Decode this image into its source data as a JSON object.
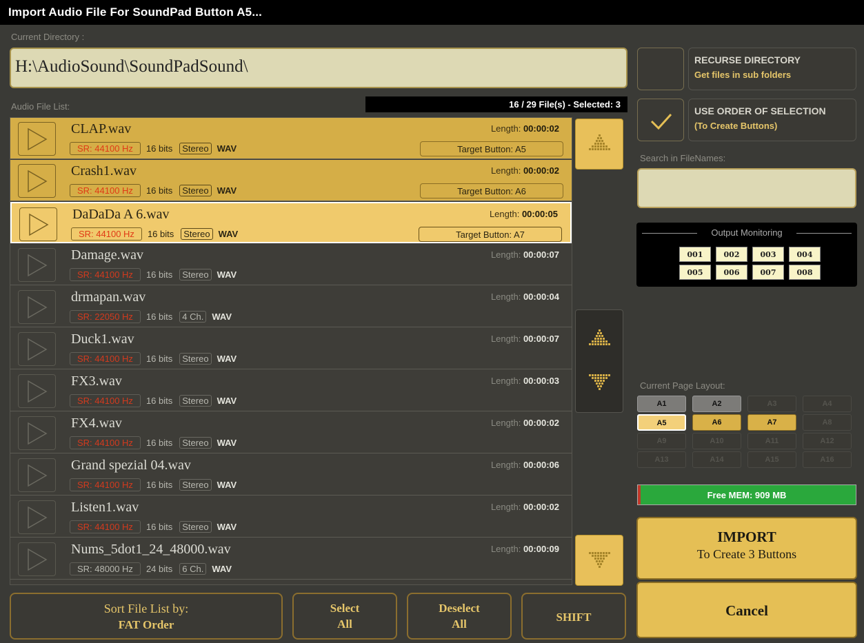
{
  "title": "Import Audio File For SoundPad Button A5...",
  "current_directory": {
    "label": "Current Directory :",
    "path": "H:\\AudioSound\\SoundPadSound\\"
  },
  "file_list": {
    "label": "Audio File List:",
    "count_text": "16 / 29 File(s) - Selected: 3",
    "length_label": "Length:",
    "bits_suffix": "bits",
    "files": [
      {
        "name": "CLAP.wav",
        "length": "00:00:02",
        "sr": "SR: 44100 Hz",
        "bits": "16",
        "channels": "Stereo",
        "format": "WAV",
        "target": "Target Button: A5",
        "state": "selected"
      },
      {
        "name": "Crash1.wav",
        "length": "00:00:02",
        "sr": "SR: 44100 Hz",
        "bits": "16",
        "channels": "Stereo",
        "format": "WAV",
        "target": "Target Button: A6",
        "state": "selected"
      },
      {
        "name": "DaDaDa A 6.wav",
        "length": "00:00:05",
        "sr": "SR: 44100 Hz",
        "bits": "16",
        "channels": "Stereo",
        "format": "WAV",
        "target": "Target Button: A7",
        "state": "current"
      },
      {
        "name": "Damage.wav",
        "length": "00:00:07",
        "sr": "SR: 44100 Hz",
        "bits": "16",
        "channels": "Stereo",
        "format": "WAV",
        "target": "",
        "state": "normal"
      },
      {
        "name": "drmapan.wav",
        "length": "00:00:04",
        "sr": "SR: 22050 Hz",
        "bits": "16",
        "channels": "4 Ch.",
        "format": "WAV",
        "target": "",
        "state": "normal"
      },
      {
        "name": "Duck1.wav",
        "length": "00:00:07",
        "sr": "SR: 44100 Hz",
        "bits": "16",
        "channels": "Stereo",
        "format": "WAV",
        "target": "",
        "state": "normal"
      },
      {
        "name": "FX3.wav",
        "length": "00:00:03",
        "sr": "SR: 44100 Hz",
        "bits": "16",
        "channels": "Stereo",
        "format": "WAV",
        "target": "",
        "state": "normal"
      },
      {
        "name": "FX4.wav",
        "length": "00:00:02",
        "sr": "SR: 44100 Hz",
        "bits": "16",
        "channels": "Stereo",
        "format": "WAV",
        "target": "",
        "state": "normal"
      },
      {
        "name": "Grand spezial 04.wav",
        "length": "00:00:06",
        "sr": "SR: 44100 Hz",
        "bits": "16",
        "channels": "Stereo",
        "format": "WAV",
        "target": "",
        "state": "normal"
      },
      {
        "name": "Listen1.wav",
        "length": "00:00:02",
        "sr": "SR: 44100 Hz",
        "bits": "16",
        "channels": "Stereo",
        "format": "WAV",
        "target": "",
        "state": "normal"
      },
      {
        "name": "Nums_5dot1_24_48000.wav",
        "length": "00:00:09",
        "sr": "SR: 48000 Hz",
        "bits": "24",
        "channels": "6 Ch.",
        "format": "WAV",
        "target": "",
        "state": "normal",
        "sr_normal": true
      }
    ]
  },
  "options": {
    "recurse": {
      "title": "RECURSE DIRECTORY",
      "subtitle": "Get files in sub folders",
      "checked": false
    },
    "order": {
      "title": "USE ORDER OF SELECTION",
      "subtitle": "(To Create Buttons)",
      "checked": true
    }
  },
  "search": {
    "label": "Search in FileNames:",
    "value": ""
  },
  "output_monitoring": {
    "title": "Output Monitoring",
    "channels": [
      "001",
      "002",
      "003",
      "004",
      "005",
      "006",
      "007",
      "008"
    ]
  },
  "page_layout": {
    "label": "Current Page Layout:",
    "buttons": [
      {
        "label": "A1",
        "state": "grey"
      },
      {
        "label": "A2",
        "state": "grey"
      },
      {
        "label": "A3",
        "state": "empty"
      },
      {
        "label": "A4",
        "state": "empty"
      },
      {
        "label": "A5",
        "state": "current"
      },
      {
        "label": "A6",
        "state": "gold"
      },
      {
        "label": "A7",
        "state": "gold"
      },
      {
        "label": "A8",
        "state": "empty"
      },
      {
        "label": "A9",
        "state": "empty"
      },
      {
        "label": "A10",
        "state": "empty"
      },
      {
        "label": "A11",
        "state": "empty"
      },
      {
        "label": "A12",
        "state": "empty"
      },
      {
        "label": "A13",
        "state": "empty"
      },
      {
        "label": "A14",
        "state": "empty"
      },
      {
        "label": "A15",
        "state": "empty"
      },
      {
        "label": "A16",
        "state": "empty"
      }
    ]
  },
  "memory": {
    "text": "Free MEM: 909 MB"
  },
  "import_button": {
    "line1": "IMPORT",
    "line2": "To Create 3 Buttons"
  },
  "cancel_button": {
    "label": "Cancel"
  },
  "bottom": {
    "sort": {
      "line1": "Sort File List by:",
      "line2": "FAT Order"
    },
    "select_all": {
      "line1": "Select",
      "line2": "All"
    },
    "deselect_all": {
      "line1": "Deselect",
      "line2": "All"
    },
    "shift": {
      "label": "SHIFT"
    }
  },
  "colors": {
    "accent": "#e5bf55",
    "selected_row": "#d5ae47",
    "current_row": "#f0ca6c",
    "memory_ok": "#2aa83c",
    "sr_text": "#d23a1e"
  }
}
